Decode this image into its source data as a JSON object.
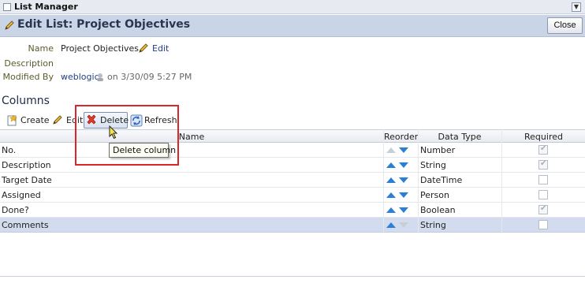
{
  "panel": {
    "title": "List Manager"
  },
  "header": {
    "title": "Edit List: Project Objectives",
    "close_label": "Close"
  },
  "properties": {
    "name_label": "Name",
    "name_value": "Project Objectives",
    "name_edit_label": "Edit",
    "description_label": "Description",
    "description_value": "",
    "modified_label": "Modified By",
    "modified_user": "weblogic",
    "modified_when": "on 3/30/09 5:27 PM"
  },
  "columns_section": {
    "title": "Columns",
    "toolbar": {
      "create": "Create",
      "edit": "Edit",
      "delete": "Delete",
      "refresh": "Refresh"
    },
    "tooltip": "Delete column",
    "headers": {
      "name": "Name",
      "reorder": "Reorder",
      "data_type": "Data Type",
      "required": "Required"
    },
    "rows": [
      {
        "name": "No.",
        "data_type": "Number",
        "required": true,
        "up_enabled": false,
        "down_enabled": true
      },
      {
        "name": "Description",
        "data_type": "String",
        "required": true,
        "up_enabled": true,
        "down_enabled": true
      },
      {
        "name": "Target Date",
        "data_type": "DateTime",
        "required": false,
        "up_enabled": true,
        "down_enabled": true
      },
      {
        "name": "Assigned",
        "data_type": "Person",
        "required": false,
        "up_enabled": true,
        "down_enabled": true
      },
      {
        "name": "Done?",
        "data_type": "Boolean",
        "required": true,
        "up_enabled": true,
        "down_enabled": true
      },
      {
        "name": "Comments",
        "data_type": "String",
        "required": false,
        "up_enabled": true,
        "down_enabled": false,
        "selected": true
      }
    ]
  },
  "colors": {
    "header_band": "#c9d4e6",
    "selected_row": "#d3dcee",
    "highlight_box": "#d9262b",
    "arrow_active": "#2c7fd6"
  },
  "icons": {
    "pencil": "pencil-icon",
    "user": "user-presence-icon",
    "create": "create-icon",
    "delete": "delete-x-icon",
    "refresh": "refresh-icon"
  }
}
